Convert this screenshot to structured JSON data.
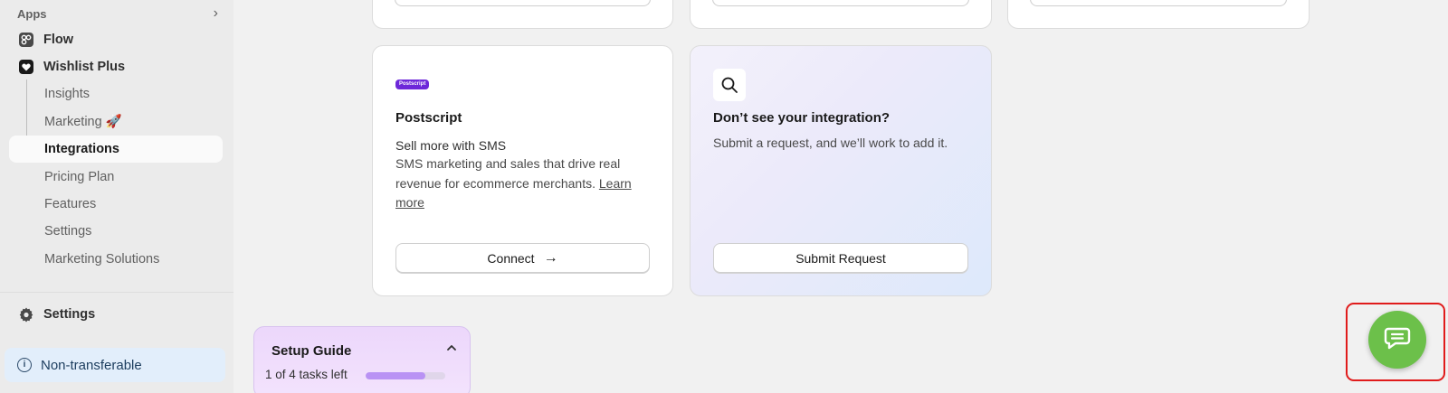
{
  "sidebar": {
    "apps_label": "Apps",
    "items": [
      {
        "label": "Flow"
      },
      {
        "label": "Wishlist Plus"
      },
      {
        "label": "Insights"
      },
      {
        "label": "Marketing 🚀"
      },
      {
        "label": "Integrations"
      },
      {
        "label": "Pricing Plan"
      },
      {
        "label": "Features"
      },
      {
        "label": "Settings"
      },
      {
        "label": "Marketing Solutions"
      }
    ],
    "settings_label": "Settings",
    "nontransferable_label": "Non-transferable",
    "icons": {
      "apps": "chevron-right-icon",
      "flow": "flow-icon",
      "wishlist": "heart-icon",
      "settings": "gear-icon",
      "info": "info-icon"
    }
  },
  "cards": {
    "postscript": {
      "logo_text": "Postscript",
      "title": "Postscript",
      "subtitle": "Sell more with SMS",
      "description": "SMS marketing and sales that drive real revenue for ecommerce merchants.",
      "link": "Learn more",
      "button_label": "Connect"
    },
    "request": {
      "title": "Don’t see your integration?",
      "description": "Submit a request, and we’ll work to add it.",
      "button_label": "Submit Request",
      "icon": "search-icon"
    }
  },
  "setup_guide": {
    "title": "Setup Guide",
    "tasks_text": "1 of 4 tasks left",
    "progress_fraction": 0.75
  },
  "chat": {
    "icon": "chat-icon",
    "brand_color": "#6cc04a",
    "highlight_color": "#e01b1b"
  }
}
